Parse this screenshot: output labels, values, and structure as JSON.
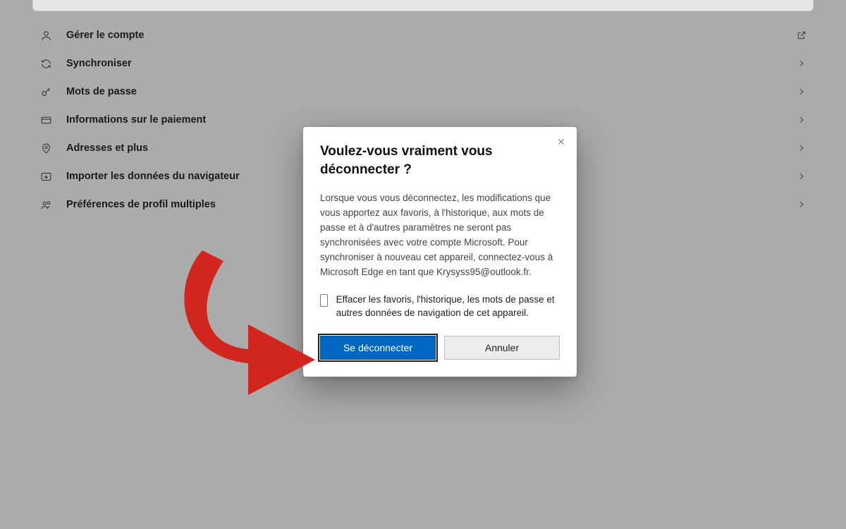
{
  "menu": {
    "items": [
      {
        "label": "Gérer le compte",
        "icon": "user-icon",
        "right": "external"
      },
      {
        "label": "Synchroniser",
        "icon": "sync-icon",
        "right": "chevron"
      },
      {
        "label": "Mots de passe",
        "icon": "key-icon",
        "right": "chevron"
      },
      {
        "label": "Informations sur le paiement",
        "icon": "card-icon",
        "right": "chevron"
      },
      {
        "label": "Adresses et plus",
        "icon": "pin-icon",
        "right": "chevron"
      },
      {
        "label": "Importer les données du navigateur",
        "icon": "import-icon",
        "right": "chevron"
      },
      {
        "label": "Préférences de profil multiples",
        "icon": "people-icon",
        "right": "chevron"
      }
    ]
  },
  "dialog": {
    "title": "Voulez-vous vraiment vous déconnecter ?",
    "body": "Lorsque vous vous déconnectez, les modifications que vous apportez aux favoris, à l'historique, aux mots de passe et à d'autres paramètres ne seront pas synchronisées avec votre compte Microsoft. Pour synchroniser à nouveau cet appareil, connectez-vous à Microsoft Edge en tant que Krysyss95@outlook.fr.",
    "checkbox_label": "Effacer les favoris, l'historique, les mots de passe et autres données de navigation de cet appareil.",
    "primary_label": "Se déconnecter",
    "secondary_label": "Annuler"
  },
  "annotation": {
    "color": "#d0261e"
  }
}
